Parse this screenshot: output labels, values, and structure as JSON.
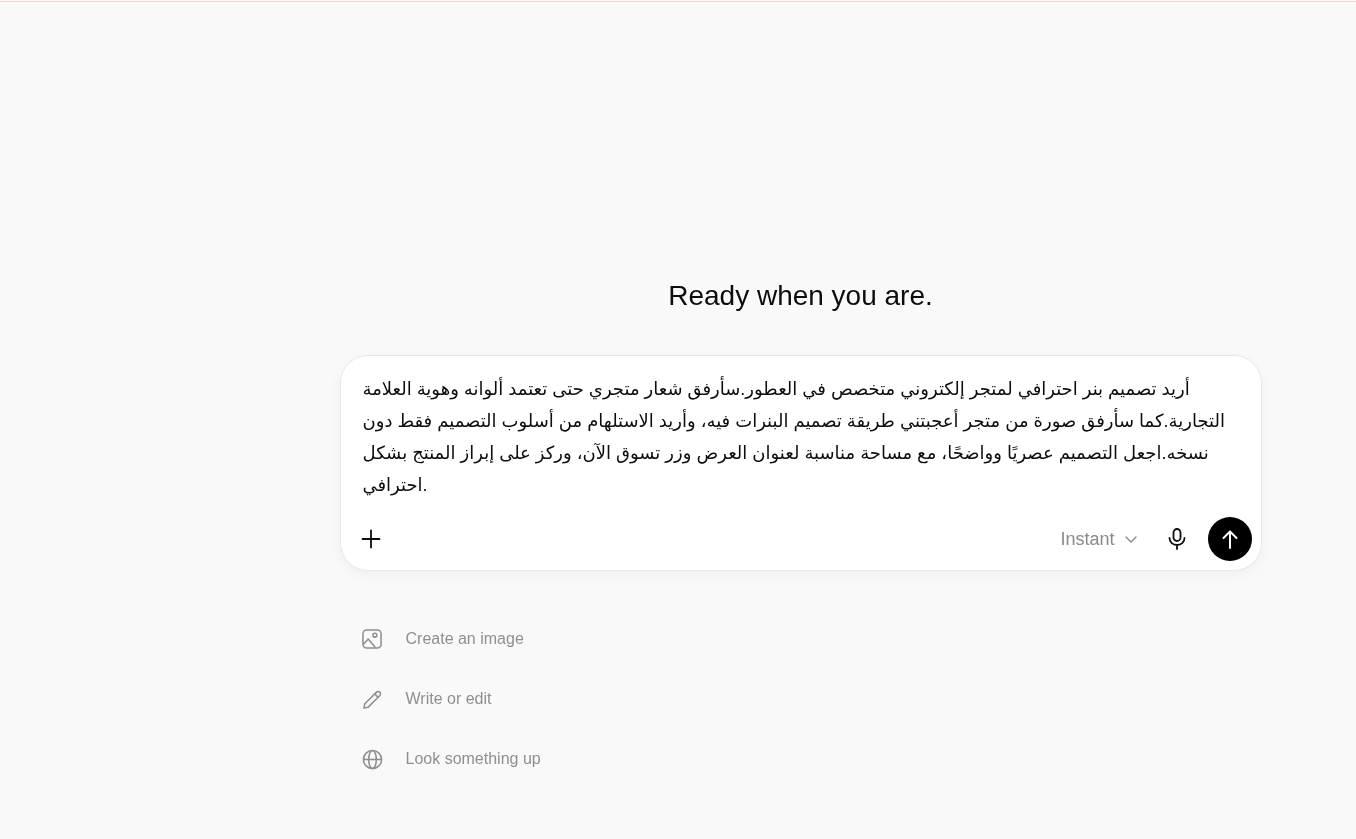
{
  "heading": "Ready when you are.",
  "composer": {
    "value": "أريد تصميم بنر احترافي لمتجر إلكتروني متخصص في العطور.سأرفق شعار متجري حتى تعتمد ألوانه وهوية العلامة التجارية.كما سأرفق صورة من متجر أعجبتني طريقة تصميم البنرات فيه، وأريد الاستلهام من أسلوب التصميم فقط دون نسخه.اجعل التصميم عصريًا وواضحًا، مع مساحة مناسبة لعنوان العرض وزر تسوق الآن، وركز على إبراز المنتج بشكل احترافي.",
    "model_selector": "Instant"
  },
  "suggestions": [
    {
      "kind": "image",
      "label": "Create an image"
    },
    {
      "kind": "pencil",
      "label": "Write or edit"
    },
    {
      "kind": "globe",
      "label": "Look something up"
    }
  ]
}
